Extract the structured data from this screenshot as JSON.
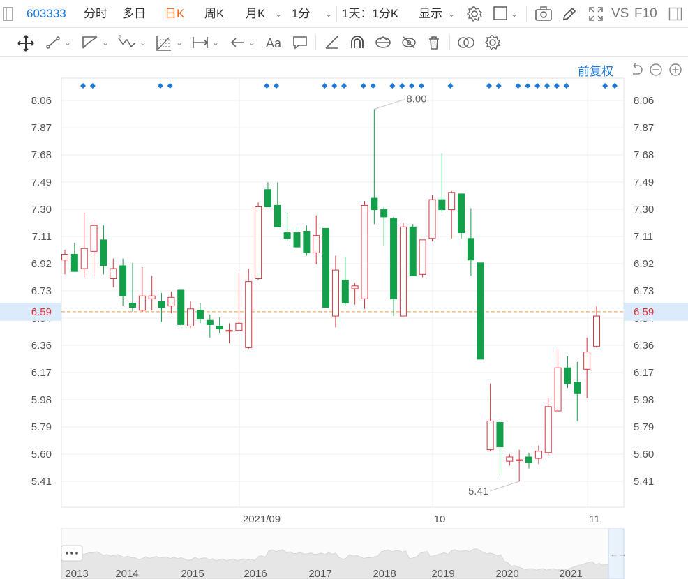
{
  "toolbar": {
    "code": "603333",
    "tabs": [
      {
        "label": "分时",
        "active": false
      },
      {
        "label": "多日",
        "active": false
      },
      {
        "label": "日K",
        "active": true
      },
      {
        "label": "周K",
        "active": false
      },
      {
        "label": "月K",
        "active": false
      },
      {
        "label": "1分",
        "active": false
      }
    ],
    "period_label": "1天：1分K",
    "display_label": "显示",
    "vs_label": "VS",
    "f10_label": "F10"
  },
  "adjust_label": "前复权",
  "colors": {
    "up": "#d9363e",
    "down": "#14a04a",
    "accent": "#1e78d6",
    "last_price_line": "#e8a04a",
    "last_price_text": "#e0303a"
  },
  "chart_data": {
    "type": "candlestick",
    "y_ticks": [
      "8.06",
      "7.87",
      "7.68",
      "7.49",
      "7.30",
      "7.11",
      "6.92",
      "6.73",
      "6.54",
      "6.36",
      "6.17",
      "5.98",
      "5.79",
      "5.60",
      "5.41"
    ],
    "ylim": [
      5.22,
      8.16
    ],
    "last_price": "6.59",
    "max_label": "8.00",
    "min_label": "5.41",
    "x_labels": [
      "2021/09",
      "10",
      "11"
    ],
    "candles": [
      {
        "o": 6.95,
        "h": 7.02,
        "l": 6.85,
        "c": 6.99
      },
      {
        "o": 6.99,
        "h": 7.07,
        "l": 6.87,
        "c": 6.87
      },
      {
        "o": 6.89,
        "h": 7.28,
        "l": 6.83,
        "c": 7.03
      },
      {
        "o": 7.01,
        "h": 7.23,
        "l": 6.84,
        "c": 7.19
      },
      {
        "o": 7.09,
        "h": 7.19,
        "l": 6.85,
        "c": 6.91
      },
      {
        "o": 6.82,
        "h": 6.96,
        "l": 6.76,
        "c": 6.89
      },
      {
        "o": 6.91,
        "h": 6.96,
        "l": 6.63,
        "c": 6.7
      },
      {
        "o": 6.65,
        "h": 6.93,
        "l": 6.59,
        "c": 6.62
      },
      {
        "o": 6.6,
        "h": 6.9,
        "l": 6.59,
        "c": 6.7
      },
      {
        "o": 6.68,
        "h": 6.84,
        "l": 6.6,
        "c": 6.7
      },
      {
        "o": 6.66,
        "h": 6.72,
        "l": 6.52,
        "c": 6.62
      },
      {
        "o": 6.63,
        "h": 6.73,
        "l": 6.58,
        "c": 6.69
      },
      {
        "o": 6.74,
        "h": 6.74,
        "l": 6.49,
        "c": 6.5
      },
      {
        "o": 6.49,
        "h": 6.66,
        "l": 6.48,
        "c": 6.61
      },
      {
        "o": 6.6,
        "h": 6.65,
        "l": 6.51,
        "c": 6.54
      },
      {
        "o": 6.53,
        "h": 6.57,
        "l": 6.41,
        "c": 6.5
      },
      {
        "o": 6.49,
        "h": 6.55,
        "l": 6.44,
        "c": 6.47
      },
      {
        "o": 6.46,
        "h": 6.51,
        "l": 6.37,
        "c": 6.46
      },
      {
        "o": 6.46,
        "h": 6.86,
        "l": 6.45,
        "c": 6.51
      },
      {
        "o": 6.34,
        "h": 6.89,
        "l": 6.33,
        "c": 6.8
      },
      {
        "o": 6.82,
        "h": 7.35,
        "l": 6.81,
        "c": 7.32
      },
      {
        "o": 7.44,
        "h": 7.49,
        "l": 7.32,
        "c": 7.32
      },
      {
        "o": 7.33,
        "h": 7.49,
        "l": 7.18,
        "c": 7.18
      },
      {
        "o": 7.14,
        "h": 7.28,
        "l": 7.08,
        "c": 7.1
      },
      {
        "o": 7.14,
        "h": 7.18,
        "l": 7.04,
        "c": 7.04
      },
      {
        "o": 7.15,
        "h": 7.19,
        "l": 6.98,
        "c": 7.0
      },
      {
        "o": 7.0,
        "h": 7.26,
        "l": 6.92,
        "c": 7.12
      },
      {
        "o": 7.17,
        "h": 7.17,
        "l": 6.62,
        "c": 6.62
      },
      {
        "o": 6.56,
        "h": 6.98,
        "l": 6.48,
        "c": 6.88
      },
      {
        "o": 6.81,
        "h": 6.97,
        "l": 6.63,
        "c": 6.65
      },
      {
        "o": 6.75,
        "h": 6.79,
        "l": 6.64,
        "c": 6.77
      },
      {
        "o": 6.68,
        "h": 7.36,
        "l": 6.61,
        "c": 7.33
      },
      {
        "o": 7.38,
        "h": 8.0,
        "l": 7.2,
        "c": 7.3
      },
      {
        "o": 7.3,
        "h": 7.32,
        "l": 7.05,
        "c": 7.25
      },
      {
        "o": 7.24,
        "h": 7.25,
        "l": 6.56,
        "c": 6.68
      },
      {
        "o": 6.56,
        "h": 7.21,
        "l": 6.56,
        "c": 7.18
      },
      {
        "o": 7.18,
        "h": 7.2,
        "l": 6.84,
        "c": 6.84
      },
      {
        "o": 6.85,
        "h": 7.09,
        "l": 6.83,
        "c": 7.09
      },
      {
        "o": 7.1,
        "h": 7.4,
        "l": 7.08,
        "c": 7.37
      },
      {
        "o": 7.37,
        "h": 7.69,
        "l": 7.28,
        "c": 7.3
      },
      {
        "o": 7.3,
        "h": 7.43,
        "l": 7.1,
        "c": 7.42
      },
      {
        "o": 7.41,
        "h": 7.41,
        "l": 7.1,
        "c": 7.14
      },
      {
        "o": 7.1,
        "h": 7.31,
        "l": 6.84,
        "c": 6.95
      },
      {
        "o": 6.93,
        "h": 6.93,
        "l": 6.26,
        "c": 6.26
      },
      {
        "o": 5.63,
        "h": 6.09,
        "l": 5.62,
        "c": 5.83
      },
      {
        "o": 5.82,
        "h": 5.83,
        "l": 5.45,
        "c": 5.65
      },
      {
        "o": 5.55,
        "h": 5.6,
        "l": 5.52,
        "c": 5.58
      },
      {
        "o": 5.56,
        "h": 5.63,
        "l": 5.41,
        "c": 5.56
      },
      {
        "o": 5.58,
        "h": 5.61,
        "l": 5.5,
        "c": 5.54
      },
      {
        "o": 5.57,
        "h": 5.66,
        "l": 5.53,
        "c": 5.62
      },
      {
        "o": 5.61,
        "h": 5.99,
        "l": 5.59,
        "c": 5.93
      },
      {
        "o": 5.9,
        "h": 6.33,
        "l": 5.89,
        "c": 6.2
      },
      {
        "o": 6.2,
        "h": 6.28,
        "l": 6.06,
        "c": 6.09
      },
      {
        "o": 6.1,
        "h": 6.24,
        "l": 5.83,
        "c": 6.02
      },
      {
        "o": 6.19,
        "h": 6.41,
        "l": 5.99,
        "c": 6.31
      },
      {
        "o": 6.35,
        "h": 6.63,
        "l": 6.34,
        "c": 6.56
      }
    ],
    "event_marker_groups": [
      [
        0,
        1
      ],
      [
        8,
        9
      ],
      [
        19,
        20
      ],
      [
        25,
        26,
        27
      ],
      [
        29,
        30
      ],
      [
        32,
        33,
        34,
        35
      ],
      [
        38
      ],
      [
        42,
        43
      ],
      [
        45,
        46,
        47,
        48,
        49,
        50
      ],
      [
        54,
        55
      ]
    ],
    "overview_x_labels": [
      "2013",
      "2014",
      "2015",
      "2016",
      "2017",
      "2018",
      "2019",
      "2020",
      "2021"
    ]
  }
}
